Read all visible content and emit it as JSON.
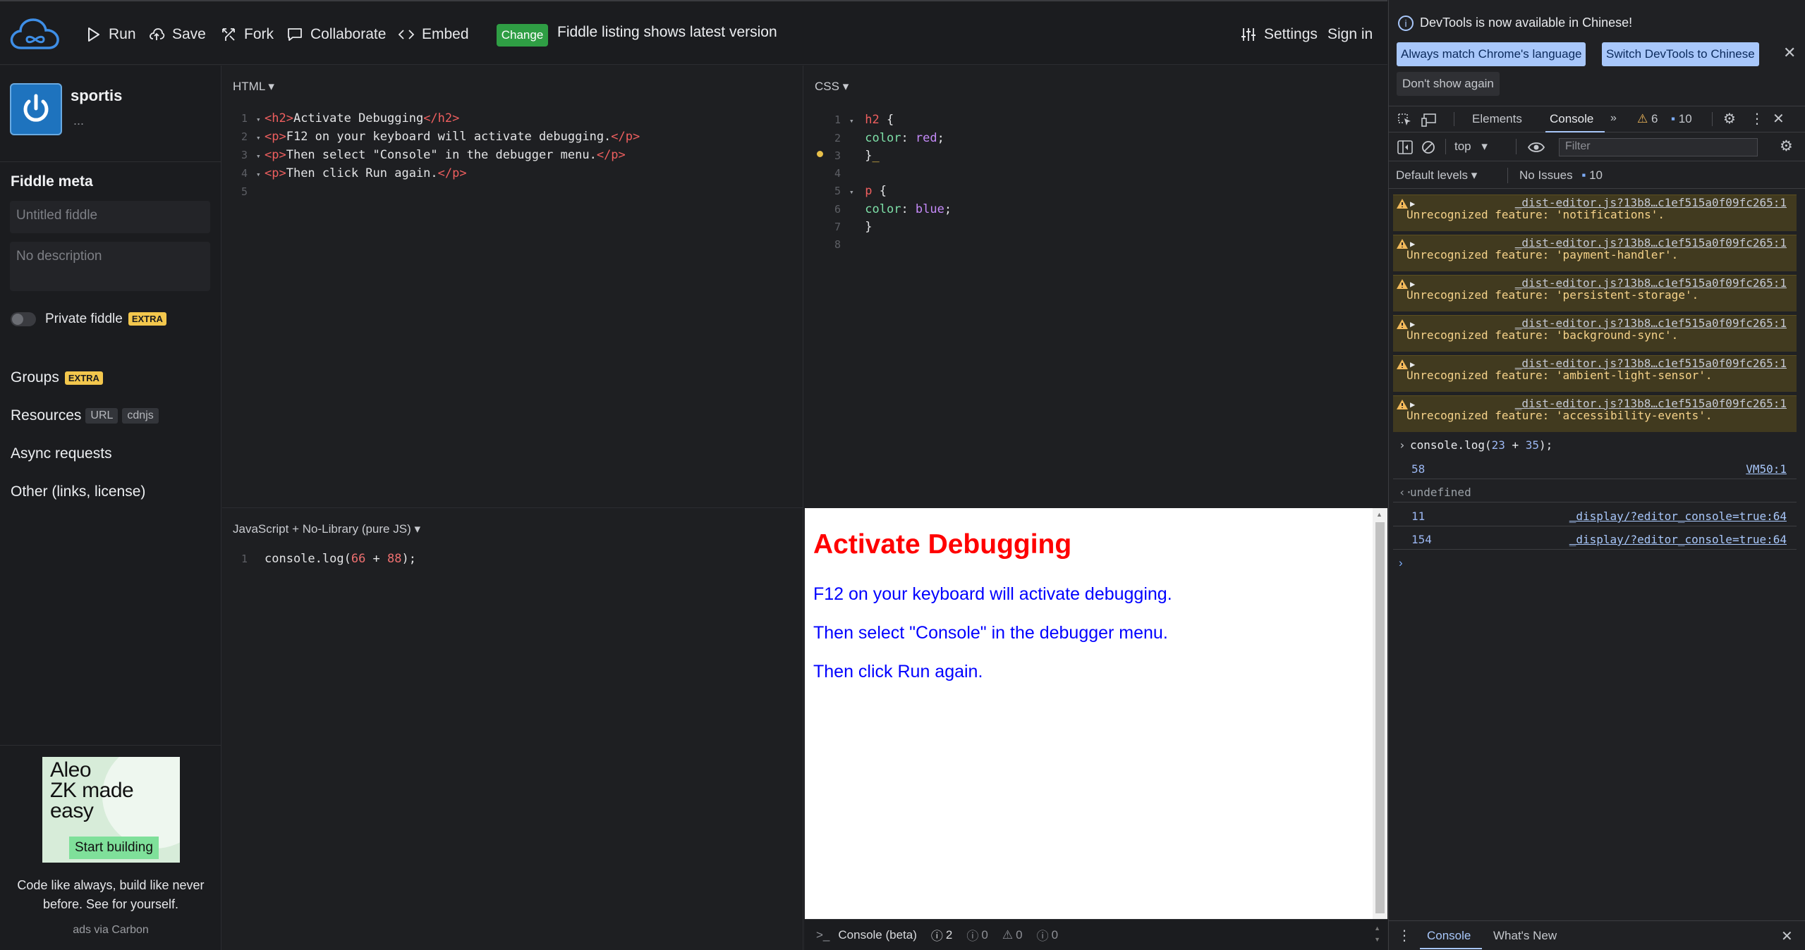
{
  "toolbar": {
    "run": "Run",
    "save": "Save",
    "fork": "Fork",
    "collaborate": "Collaborate",
    "embed": "Embed",
    "change": "Change",
    "listing_text": "Fiddle listing shows latest version",
    "settings": "Settings",
    "sign_in": "Sign in"
  },
  "sidebar": {
    "username": "sportis",
    "user_more": "...",
    "meta_title": "Fiddle meta",
    "title_placeholder": "Untitled fiddle",
    "description_placeholder": "No description",
    "private_label": "Private fiddle",
    "extra_badge": "EXTRA",
    "groups": "Groups",
    "resources": "Resources",
    "resources_url": "URL",
    "resources_cdnjs": "cdnjs",
    "async_requests": "Async requests",
    "other": "Other (links, license)",
    "ad": {
      "headline": "Aleo\nZK made\neasy",
      "cta": "Start building",
      "text": "Code like always, build like never before. See for yourself.",
      "via": "ads via Carbon"
    }
  },
  "panels": {
    "html_label": "HTML",
    "css_label": "CSS",
    "js_label": "JavaScript + No-Library (pure JS)"
  },
  "html_code": [
    {
      "n": "1",
      "open": "<h2>",
      "text": "Activate Debugging",
      "close": "</h2>"
    },
    {
      "n": "2",
      "open": "<p>",
      "text": "F12 on your keyboard will activate debugging.",
      "close": "</p>"
    },
    {
      "n": "3",
      "open": "<p>",
      "text": "Then select \"Console\" in the debugger menu.",
      "close": "</p>"
    },
    {
      "n": "4",
      "open": "<p>",
      "text": "Then click Run again.",
      "close": "</p>"
    },
    {
      "n": "5"
    }
  ],
  "css_code": {
    "line_numbers": [
      "1",
      "2",
      "3",
      "4",
      "5",
      "6",
      "7",
      "8"
    ],
    "rule1_selector": "h2",
    "rule1_prop": "color",
    "rule1_value": "red",
    "rule2_selector": "p",
    "rule2_prop": "color",
    "rule2_value": "blue"
  },
  "js_code": {
    "line": "1",
    "fn": "console.log(",
    "a": "66",
    "op": " + ",
    "b": "88",
    "end": ");"
  },
  "result": {
    "heading": "Activate Debugging",
    "p1": "F12 on your keyboard will activate debugging.",
    "p2": "Then select \"Console\" in the debugger menu.",
    "p3": "Then click Run again."
  },
  "console_bar": {
    "label": "Console (beta)",
    "info_count": "2",
    "error_count": "0",
    "warn_count": "0",
    "log_count": "0"
  },
  "devtools": {
    "info_text": "DevTools is now available in Chinese!",
    "btn_match": "Always match Chrome's language",
    "btn_switch": "Switch DevTools to Chinese",
    "btn_dont_show": "Don't show again",
    "tab_elements": "Elements",
    "tab_console": "Console",
    "warn_count": "6",
    "msg_count": "10",
    "context": "top",
    "filter_placeholder": "Filter",
    "default_levels": "Default levels",
    "no_issues": "No Issues",
    "issues_count": "10",
    "warnings": [
      {
        "src": "_dist-editor.js?13b8…c1ef515a0f09fc265:1",
        "msg": "Unrecognized feature: 'notifications'."
      },
      {
        "src": "_dist-editor.js?13b8…c1ef515a0f09fc265:1",
        "msg": "Unrecognized feature: 'payment-handler'."
      },
      {
        "src": "_dist-editor.js?13b8…c1ef515a0f09fc265:1",
        "msg": "Unrecognized feature: 'persistent-storage'."
      },
      {
        "src": "_dist-editor.js?13b8…c1ef515a0f09fc265:1",
        "msg": "Unrecognized feature: 'background-sync'."
      },
      {
        "src": "_dist-editor.js?13b8…c1ef515a0f09fc265:1",
        "msg": "Unrecognized feature: 'ambient-light-sensor'."
      },
      {
        "src": "_dist-editor.js?13b8…c1ef515a0f09fc265:1",
        "msg": "Unrecognized feature: 'accessibility-events'."
      }
    ],
    "input_fn": "console.log(",
    "input_a": "23",
    "input_op": " + ",
    "input_b": "35",
    "input_end": ");",
    "output_value": "58",
    "output_src": "VM50:1",
    "return_value": "undefined",
    "log1_value": "11",
    "log1_src": "_display/?editor_console=true:64",
    "log2_value": "154",
    "log2_src": "_display/?editor_console=true:64",
    "drawer_console": "Console",
    "drawer_whats_new": "What's New"
  },
  "colors": {
    "accent_green": "#2f9e44",
    "result_heading": "#ff0000",
    "result_text": "#0000ff",
    "devtools_button": "#a8c7fa",
    "warning_bg": "#413a1f"
  }
}
